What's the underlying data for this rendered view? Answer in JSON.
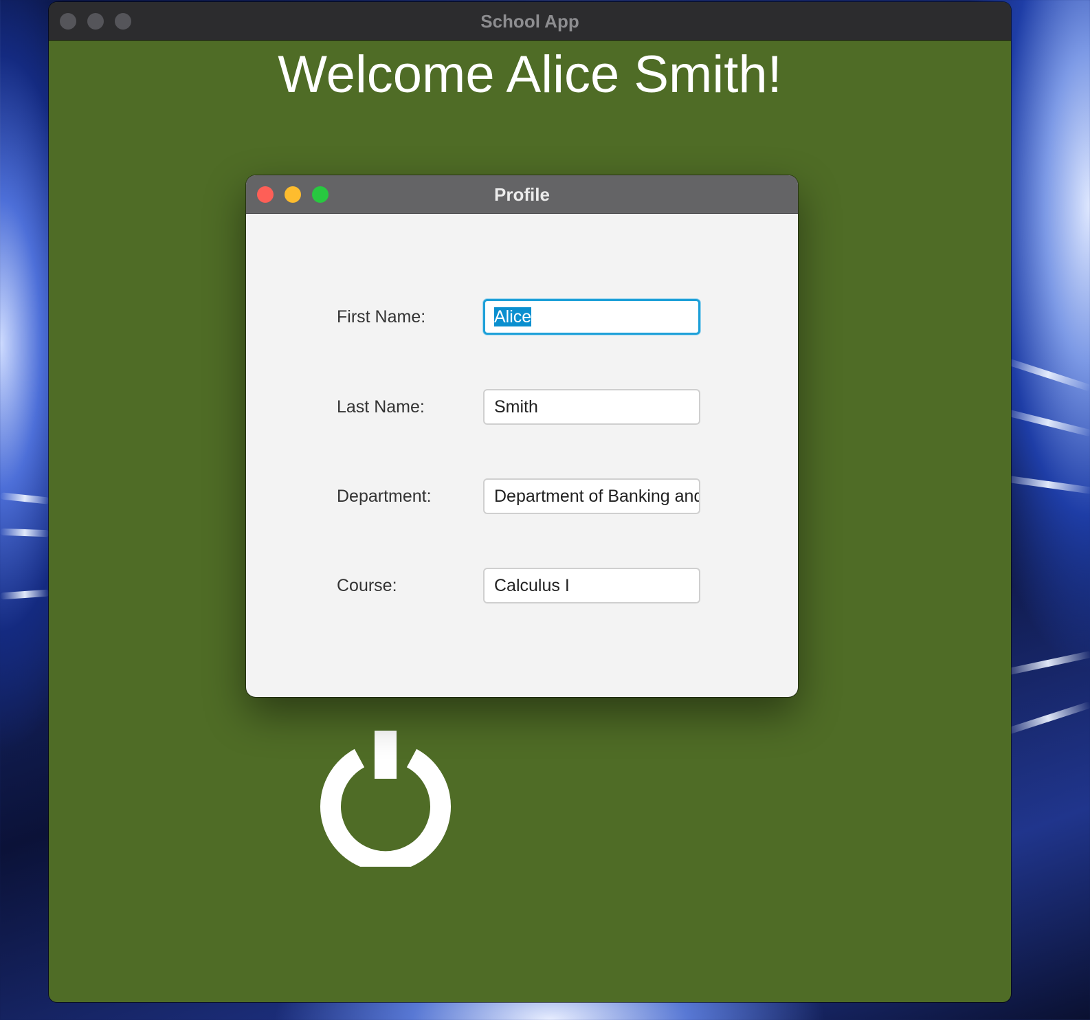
{
  "main_window": {
    "title": "School App",
    "welcome_text": "Welcome Alice Smith!"
  },
  "profile_dialog": {
    "title": "Profile",
    "fields": {
      "first_name": {
        "label": "First Name:",
        "value": "Alice"
      },
      "last_name": {
        "label": "Last Name:",
        "value": "Smith"
      },
      "department": {
        "label": "Department:",
        "value": "Department of Banking and"
      },
      "course": {
        "label": "Course:",
        "value": "Calculus I"
      }
    }
  },
  "icons": {
    "power": "power-icon"
  },
  "colors": {
    "window_background": "#4f6c26",
    "focus_ring": "#1ea0d8",
    "selection": "#0a8fcf"
  }
}
